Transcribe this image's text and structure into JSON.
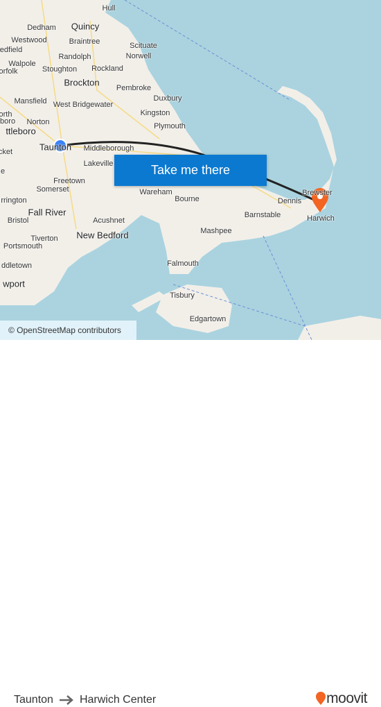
{
  "map": {
    "towns": [
      {
        "name": "Hull",
        "big": false
      },
      {
        "name": "Dedham",
        "big": false
      },
      {
        "name": "Quincy",
        "big": true
      },
      {
        "name": "Westwood",
        "big": false
      },
      {
        "name": "Braintree",
        "big": false
      },
      {
        "name": "Scituate",
        "big": false
      },
      {
        "name": "edfield",
        "big": false
      },
      {
        "name": "Randolph",
        "big": false
      },
      {
        "name": "Norwell",
        "big": false
      },
      {
        "name": "Walpole",
        "big": false
      },
      {
        "name": "Stoughton",
        "big": false
      },
      {
        "name": "Rockland",
        "big": false
      },
      {
        "name": "orfolk",
        "big": false
      },
      {
        "name": "Brockton",
        "big": true
      },
      {
        "name": "Pembroke",
        "big": false
      },
      {
        "name": "Mansfield",
        "big": false
      },
      {
        "name": "West Bridgewater",
        "big": false
      },
      {
        "name": "Duxbury",
        "big": false
      },
      {
        "name": "orth",
        "big": false
      },
      {
        "name": "Kingston",
        "big": false
      },
      {
        "name": "eboro",
        "big": false
      },
      {
        "name": "Norton",
        "big": false
      },
      {
        "name": "Plymouth",
        "big": false
      },
      {
        "name": "ttleboro",
        "big": true
      },
      {
        "name": "Taunton",
        "big": true
      },
      {
        "name": "Middleborough",
        "big": false
      },
      {
        "name": "cket",
        "big": false
      },
      {
        "name": "Lakeville",
        "big": false
      },
      {
        "name": "e",
        "big": false
      },
      {
        "name": "Freetown",
        "big": false
      },
      {
        "name": "Somerset",
        "big": false
      },
      {
        "name": "Wareham",
        "big": false
      },
      {
        "name": "Brewster",
        "big": false
      },
      {
        "name": "rrington",
        "big": false
      },
      {
        "name": "Bourne",
        "big": false
      },
      {
        "name": "Dennis",
        "big": false
      },
      {
        "name": "Fall River",
        "big": true
      },
      {
        "name": "Barnstable",
        "big": false
      },
      {
        "name": "Harwich",
        "big": false
      },
      {
        "name": "Bristol",
        "big": false
      },
      {
        "name": "Acushnet",
        "big": false
      },
      {
        "name": "Mashpee",
        "big": false
      },
      {
        "name": "Portsmouth",
        "big": false
      },
      {
        "name": "Tiverton",
        "big": false
      },
      {
        "name": "New Bedford",
        "big": true
      },
      {
        "name": "ddletown",
        "big": false
      },
      {
        "name": "Falmouth",
        "big": false
      },
      {
        "name": "wport",
        "big": true
      },
      {
        "name": "Tisbury",
        "big": false
      },
      {
        "name": "Edgartown",
        "big": false
      }
    ],
    "colors": {
      "water": "#aad3df",
      "land": "#f2efe9",
      "route": "#222222",
      "origin": "#3b82f6",
      "destination": "#f26522"
    },
    "origin_icon": "blue-dot-icon",
    "destination_icon": "map-pin-icon"
  },
  "cta_label": "Take me there",
  "attribution": "© OpenStreetMap contributors",
  "footer": {
    "from": "Taunton",
    "arrow_icon": "arrow-right-icon",
    "to": "Harwich Center",
    "brand": "moovit"
  }
}
